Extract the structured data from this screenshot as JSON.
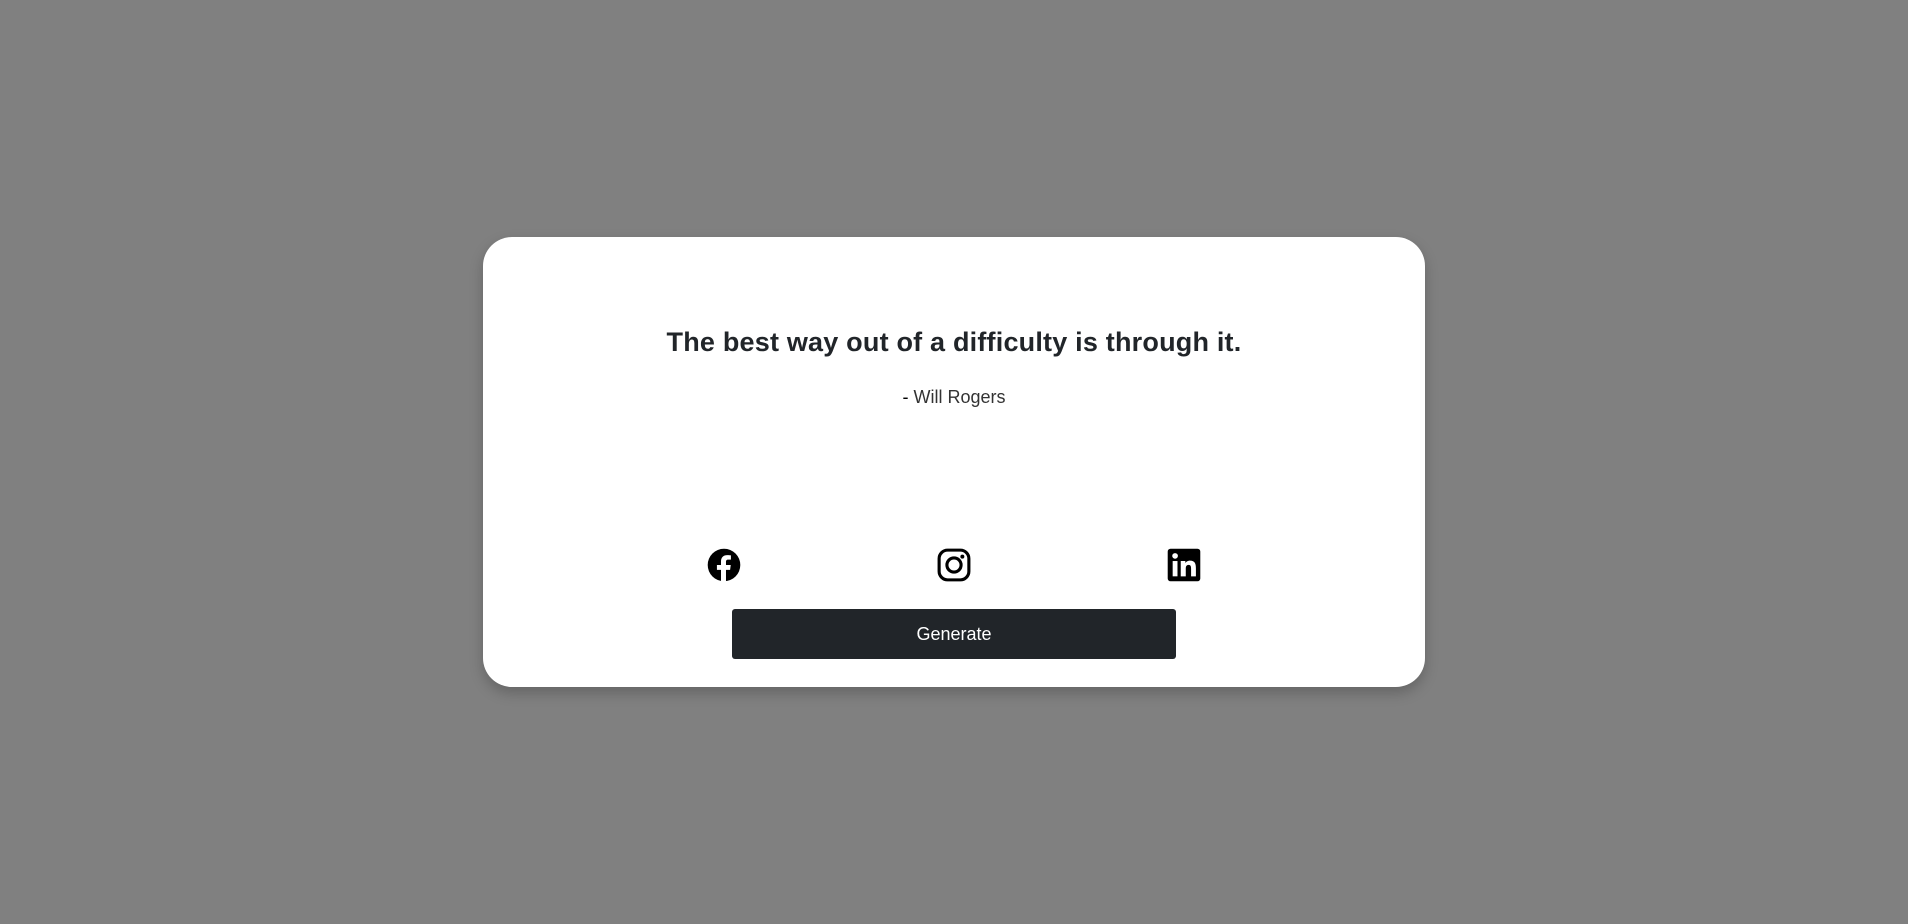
{
  "quote": {
    "text": "The best way out of a difficulty is through it.",
    "dash": "-",
    "author": "Will Rogers"
  },
  "social": {
    "icons": [
      "facebook-icon",
      "instagram-icon",
      "linkedin-icon"
    ]
  },
  "actions": {
    "generate_label": "Generate"
  },
  "colors": {
    "page_background": "#808080",
    "card_background": "#ffffff",
    "button_background": "#212529",
    "text_primary": "#212529"
  }
}
